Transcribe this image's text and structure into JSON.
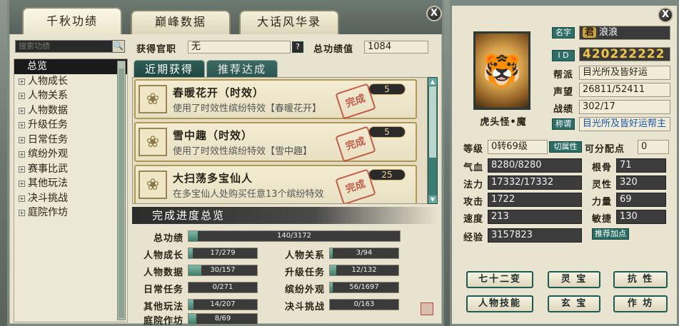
{
  "left_window": {
    "tabs": [
      "千秋功绩",
      "巅峰数据",
      "大话风华录"
    ],
    "search_placeholder": "搜索功绩",
    "tree": [
      {
        "label": "总览",
        "selected": true
      },
      {
        "label": "人物成长"
      },
      {
        "label": "人物关系"
      },
      {
        "label": "人物数据"
      },
      {
        "label": "升级任务"
      },
      {
        "label": "日常任务"
      },
      {
        "label": "缤纷外观"
      },
      {
        "label": "赛事比武"
      },
      {
        "label": "其他玩法"
      },
      {
        "label": "决斗挑战"
      },
      {
        "label": "庭院作坊"
      }
    ],
    "official_label": "获得官职",
    "official_value": "无",
    "total_label": "总功绩值",
    "total_value": "1084",
    "subtabs": [
      "近期获得",
      "推荐达成"
    ],
    "achievements": [
      {
        "title": "春暖花开（时效）",
        "desc": "使用了时效性缤纷特效【春暖花开】",
        "points": "5",
        "stamp": "完成"
      },
      {
        "title": "雪中趣（时效）",
        "desc": "使用了时效性缤纷特效【雪中趣】",
        "points": "5",
        "stamp": "完成"
      },
      {
        "title": "大扫荡多宝仙人",
        "desc": "在多宝仙人处购买任意13个缤纷特效",
        "points": "25",
        "stamp": "完成"
      }
    ],
    "progress_title": "完成进度总览",
    "progress": [
      {
        "label": "总功绩",
        "value": "140/3172",
        "fraction": 0.044
      },
      {
        "label": "人物成长",
        "value": "17/279",
        "fraction": 0.061
      },
      {
        "label": "人物关系",
        "value": "3/94",
        "fraction": 0.032
      },
      {
        "label": "人物数据",
        "value": "30/157",
        "fraction": 0.191
      },
      {
        "label": "升级任务",
        "value": "12/132",
        "fraction": 0.091
      },
      {
        "label": "日常任务",
        "value": "0/271",
        "fraction": 0.0
      },
      {
        "label": "缤纷外观",
        "value": "56/1697",
        "fraction": 0.033
      },
      {
        "label": "其他玩法",
        "value": "14/207",
        "fraction": 0.068
      },
      {
        "label": "决斗挑战",
        "value": "0/163",
        "fraction": 0.0
      },
      {
        "label": "庭院作坊",
        "value": "8/69",
        "fraction": 0.116
      }
    ]
  },
  "right_window": {
    "char_name": "虎头怪•魔",
    "name_tag": "名字",
    "name_badge": "君",
    "name_value": "浪浪",
    "id_tag": "I D",
    "id_value": "420222222",
    "faction_label": "帮派",
    "faction_value": "目光所及皆好运",
    "fame_label": "声望",
    "fame_value": "26811/52411",
    "battle_label": "战绩",
    "battle_value": "302/17",
    "title_tag": "称谓",
    "title_value": "目光所及皆好运帮主",
    "level_label": "等级",
    "level_value": "0转69级",
    "switch_attr": "切属性",
    "free_points_label": "可分配点",
    "free_points_value": "0",
    "stats_left": [
      {
        "label": "气血",
        "value": "8280/8280"
      },
      {
        "label": "法力",
        "value": "17332/17332"
      },
      {
        "label": "攻击",
        "value": "1722"
      },
      {
        "label": "速度",
        "value": "213"
      },
      {
        "label": "经验",
        "value": "3157823"
      }
    ],
    "stats_right": [
      {
        "label": "根骨",
        "value": "71"
      },
      {
        "label": "灵性",
        "value": "320"
      },
      {
        "label": "力量",
        "value": "69"
      },
      {
        "label": "敏捷",
        "value": "130"
      }
    ],
    "recommend_btn": "推荐加点",
    "buttons_row1": [
      "七十二变",
      "灵 宝",
      "抗 性"
    ],
    "buttons_row2": [
      "人物技能",
      "玄 宝",
      "作 坊"
    ]
  }
}
